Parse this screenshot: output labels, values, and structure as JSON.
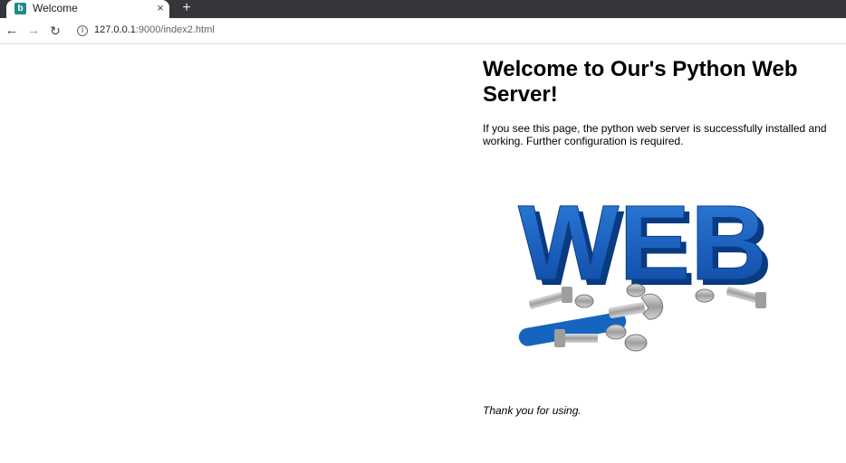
{
  "browser": {
    "tab": {
      "title": "Welcome",
      "close_glyph": "×"
    },
    "new_tab_glyph": "+",
    "address": {
      "host": "127.0.0.1",
      "port_path": ":9000/index2.html"
    },
    "icons": {
      "back": "←",
      "forward": "→",
      "reload": "↻",
      "info": "i",
      "favicon": "b"
    }
  },
  "page": {
    "heading": "Welcome to Our's Python Web Server!",
    "intro": "If you see this page, the python web server is successfully installed and working. Further configuration is required.",
    "image_text": "WEB",
    "thanks": "Thank you for using."
  },
  "colors": {
    "accent_blue": "#1565c0",
    "tabstrip": "#35363a"
  }
}
